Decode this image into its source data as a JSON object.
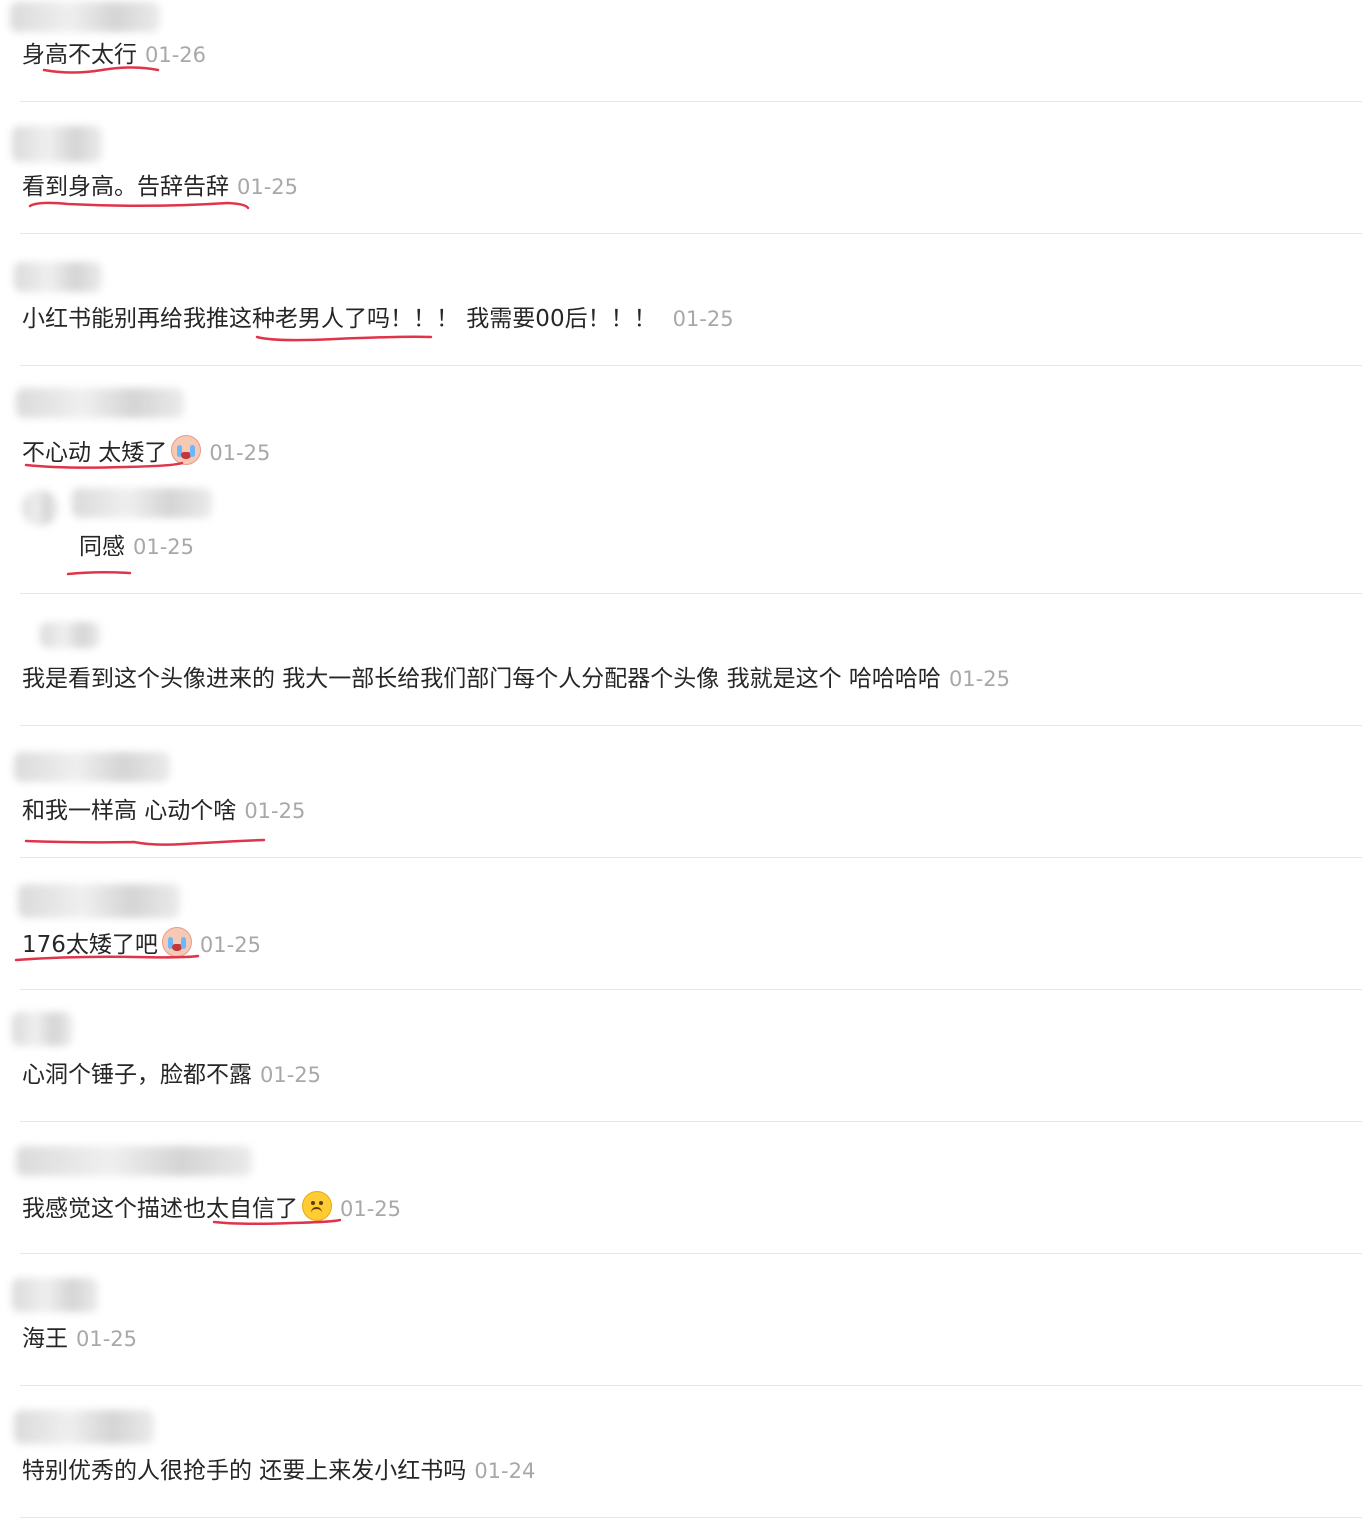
{
  "comments": [
    {
      "text": "身高不太行",
      "date": "01-26"
    },
    {
      "text": "看到身高。告辞告辞",
      "date": "01-25"
    },
    {
      "text": "小红书能别再给我推这种老男人了吗！！！ 我需要00后！！！",
      "date": "01-25"
    },
    {
      "text": "不心动 太矮了",
      "date": "01-25",
      "reply": {
        "text": "同感",
        "date": "01-25"
      }
    },
    {
      "text": "我是看到这个头像进来的 我大一部长给我们部门每个人分配器个头像 我就是这个 哈哈哈哈",
      "date": "01-25"
    },
    {
      "text": "和我一样高 心动个啥",
      "date": "01-25"
    },
    {
      "text": "176太矮了吧",
      "date": "01-25"
    },
    {
      "text": "心洞个锤子，脸都不露",
      "date": "01-25"
    },
    {
      "text": "我感觉这个描述也太自信了",
      "date": "01-25"
    },
    {
      "text": "海王",
      "date": "01-25"
    },
    {
      "text": "特别优秀的人很抢手的 还要上来发小红书吗",
      "date": "01-24"
    }
  ],
  "icons": {
    "cry": "loudly-crying-face-emoji",
    "upside_down": "upside-down-face-emoji"
  },
  "colors": {
    "underline": "#e0344a",
    "date": "#a8a8a8",
    "divider": "#e6e6e6"
  }
}
